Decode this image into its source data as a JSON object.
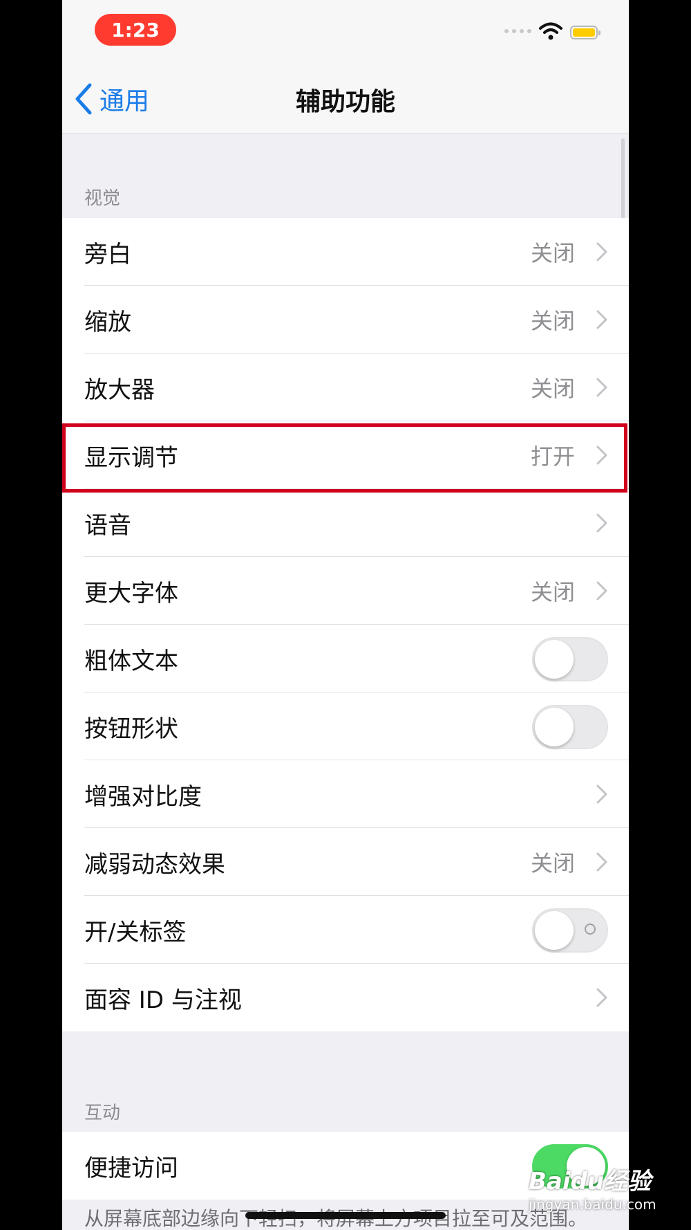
{
  "status_bar": {
    "time": "1:23"
  },
  "nav": {
    "back_label": "通用",
    "title": "辅助功能"
  },
  "sections": {
    "vision": {
      "header": "视觉",
      "items": [
        {
          "label": "旁白",
          "value": "关闭"
        },
        {
          "label": "缩放",
          "value": "关闭"
        },
        {
          "label": "放大器",
          "value": "关闭"
        },
        {
          "label": "显示调节",
          "value": "打开"
        },
        {
          "label": "语音",
          "value": ""
        },
        {
          "label": "更大字体",
          "value": "关闭"
        },
        {
          "label": "粗体文本",
          "toggle": false
        },
        {
          "label": "按钮形状",
          "toggle": false
        },
        {
          "label": "增强对比度",
          "value": ""
        },
        {
          "label": "减弱动态效果",
          "value": "关闭"
        },
        {
          "label": "开/关标签",
          "toggle": false
        },
        {
          "label": "面容 ID 与注视",
          "value": ""
        }
      ]
    },
    "interaction": {
      "header": "互动",
      "items": [
        {
          "label": "便捷访问",
          "toggle": true
        }
      ],
      "footer": "从屏幕底部边缘向下轻扫，将屏幕上方项目拉至可及范围。"
    }
  },
  "watermark": {
    "main": "Baidu经验",
    "sub": "jingyan.baidu.com"
  },
  "colors": {
    "accent": "#1a7ce8",
    "highlight": "#d0021b",
    "toggle_on": "#4cd964",
    "time_pill": "#ff3b30"
  }
}
